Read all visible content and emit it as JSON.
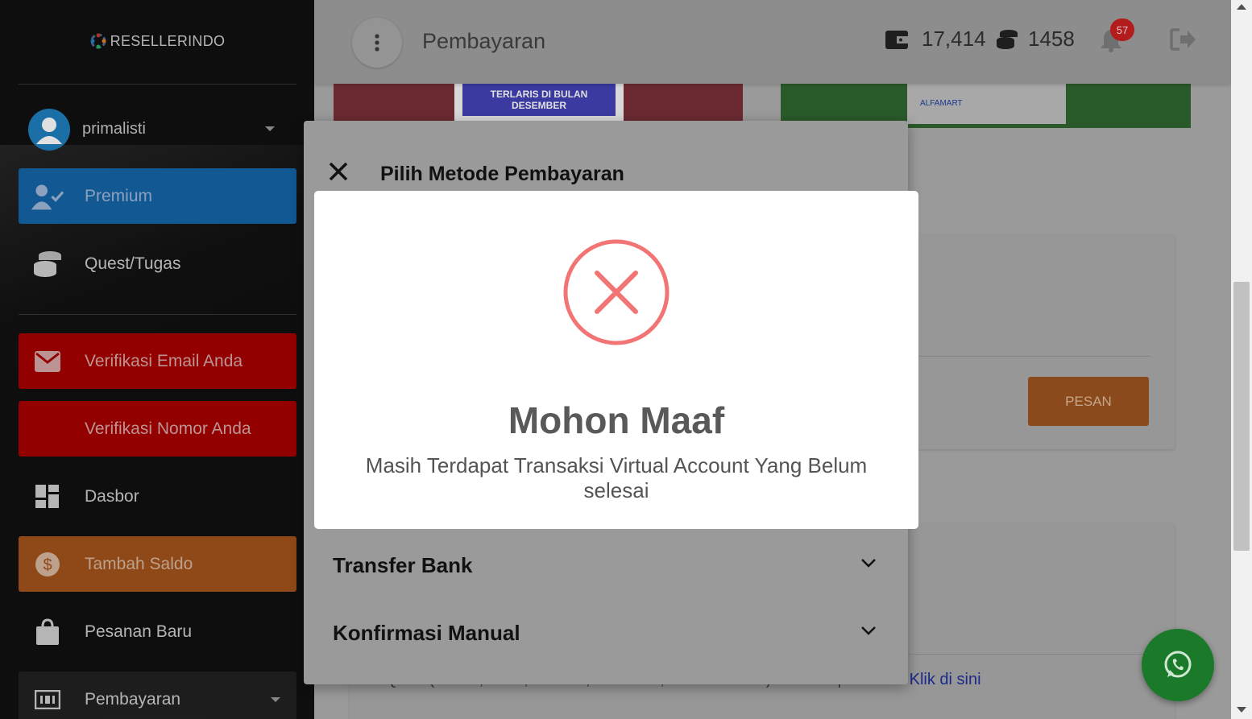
{
  "app": {
    "logo_text": "RESELLERINDO"
  },
  "sidebar": {
    "user": {
      "name": "primalisti"
    },
    "items": [
      {
        "label": "Premium",
        "icon": "user-check-icon"
      },
      {
        "label": "Quest/Tugas",
        "icon": "coins-stack-icon"
      },
      {
        "label": "Verifikasi Email Anda",
        "icon": "envelope-icon"
      },
      {
        "label": "Verifikasi Nomor Anda",
        "icon": ""
      },
      {
        "label": "Dasbor",
        "icon": "dashboard-icon"
      },
      {
        "label": "Tambah Saldo",
        "icon": "dollar-circle-icon"
      },
      {
        "label": "Pesanan Baru",
        "icon": "shopping-bag-icon"
      },
      {
        "label": "Pembayaran",
        "icon": "money-bill-icon"
      }
    ]
  },
  "header": {
    "title": "Pembayaran",
    "wallet_balance": "17,414",
    "coins": "1458",
    "notification_count": "57"
  },
  "main": {
    "banner_left_text": "TERLARIS DI BULAN DESEMBER",
    "banner_right_text": "ALFAMART",
    "order_button": "PESAN",
    "footer_text": "QRIS (DANA, OVO, GOPAY, LINKAJA, SHOPEEPAY) senilai Rp. 10.000",
    "footer_link": "Klik di sini"
  },
  "payment_modal": {
    "title": "Pilih Metode Pembayaran",
    "sections": [
      "Transfer Bank",
      "Konfirmasi Manual"
    ]
  },
  "alert": {
    "title": "Mohon Maaf",
    "message": "Masih Terdapat Transaksi Virtual Account Yang Belum selesai"
  },
  "colors": {
    "premium": "#1565a8",
    "verify_red": "#a80000",
    "saldo_orange": "#a3531b",
    "error_icon": "#f27474",
    "whatsapp": "#25d366",
    "badge": "#b21c1c"
  }
}
